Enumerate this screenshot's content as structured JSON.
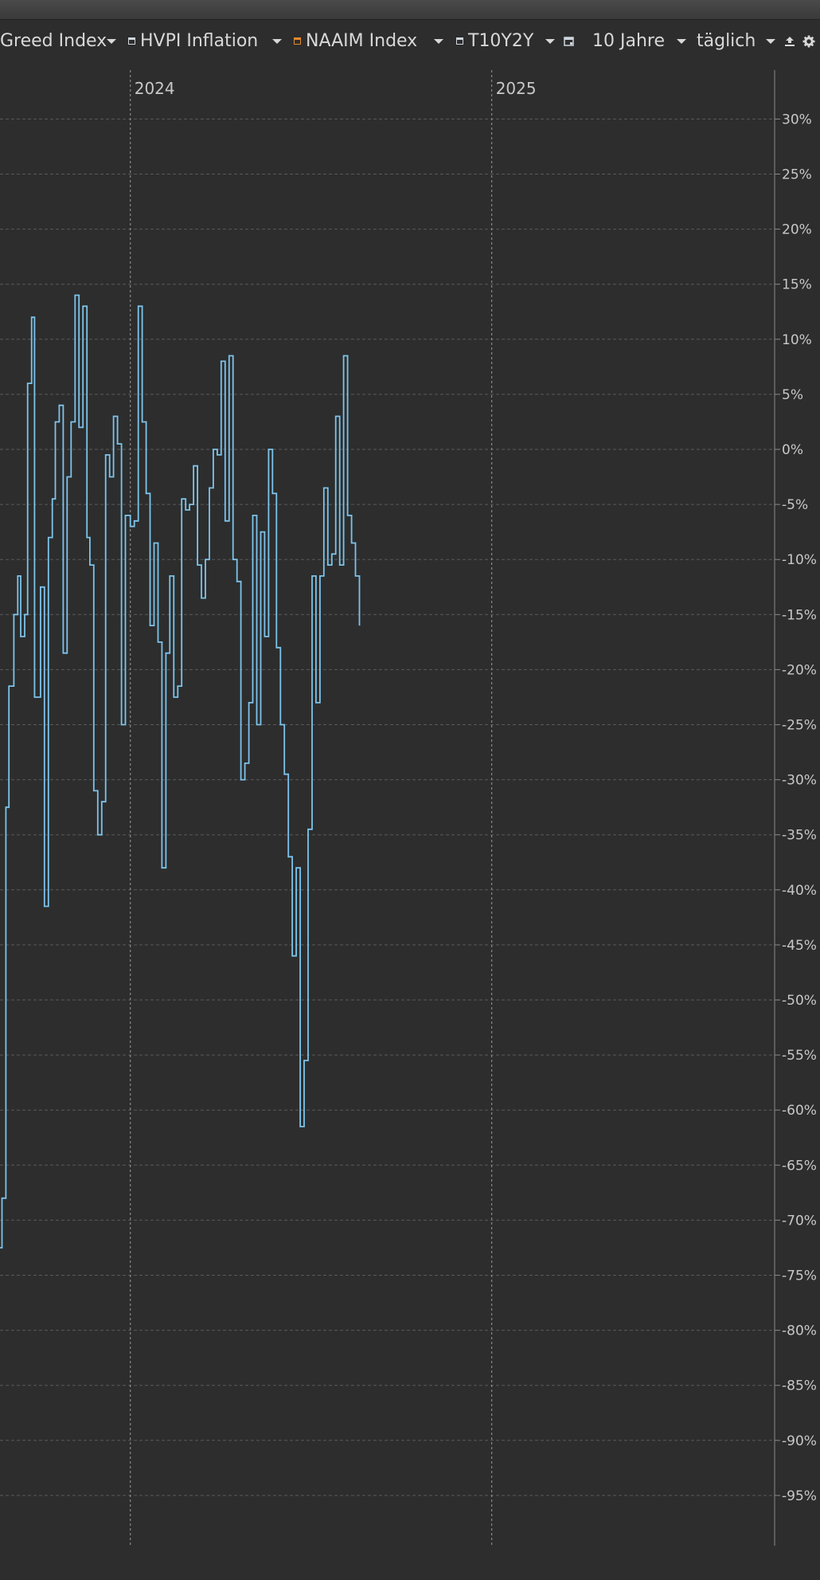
{
  "toolbar": {
    "items": [
      {
        "label": "Greed Index",
        "swatch": null
      },
      {
        "label": "HVPI Inflation",
        "swatch": "#cfd6dd"
      },
      {
        "label": "NAAIM Index",
        "swatch": "#e38a2a"
      },
      {
        "label": "T10Y2Y",
        "swatch": "#cfd6dd"
      }
    ],
    "period_label": "10 Jahre",
    "interval_label": "täglich",
    "icons": [
      "calendar-icon",
      "export-icon",
      "gear-icon"
    ]
  },
  "colors": {
    "background": "#2d2d2d",
    "line": "#7cc4ec",
    "grid": "#5a5a5a",
    "text": "#c8c8c8"
  },
  "chart_data": {
    "type": "line",
    "x_tick_labels": [
      "2024",
      "2025"
    ],
    "y_ticks": [
      "30%",
      "25%",
      "20%",
      "15%",
      "10%",
      "5%",
      "0%",
      "-5%",
      "-10%",
      "-15%",
      "-20%",
      "-25%",
      "-30%",
      "-35%",
      "-40%",
      "-45%",
      "-50%",
      "-55%",
      "-60%",
      "-65%",
      "-70%",
      "-75%",
      "-80%",
      "-85%",
      "-90%",
      "-95%"
    ],
    "ylim": [
      -100,
      33
    ],
    "x_range": [
      "2023-08-22",
      "2025-10-08"
    ],
    "grid": true,
    "line_style": "step",
    "series": [
      {
        "values": [
          [
            "2023-08-22",
            -72.5
          ],
          [
            "2023-08-24",
            -68
          ],
          [
            "2023-08-28",
            -32.5
          ],
          [
            "2023-08-31",
            -21.5
          ],
          [
            "2023-09-05",
            -15
          ],
          [
            "2023-09-09",
            -11.5
          ],
          [
            "2023-09-12",
            -17
          ],
          [
            "2023-09-16",
            -15
          ],
          [
            "2023-09-19",
            6
          ],
          [
            "2023-09-23",
            12
          ],
          [
            "2023-09-26",
            -22.5
          ],
          [
            "2023-10-02",
            -12.5
          ],
          [
            "2023-10-06",
            -41.5
          ],
          [
            "2023-10-10",
            -8
          ],
          [
            "2023-10-14",
            -4.5
          ],
          [
            "2023-10-17",
            2.5
          ],
          [
            "2023-10-21",
            4
          ],
          [
            "2023-10-25",
            -18.5
          ],
          [
            "2023-10-29",
            -2.5
          ],
          [
            "2023-11-02",
            2.5
          ],
          [
            "2023-11-06",
            14
          ],
          [
            "2023-11-10",
            2
          ],
          [
            "2023-11-14",
            13
          ],
          [
            "2023-11-18",
            -8
          ],
          [
            "2023-11-21",
            -10.5
          ],
          [
            "2023-11-25",
            -31
          ],
          [
            "2023-11-29",
            -35
          ],
          [
            "2023-12-03",
            -32
          ],
          [
            "2023-12-07",
            -0.5
          ],
          [
            "2023-12-11",
            -2.5
          ],
          [
            "2023-12-15",
            3
          ],
          [
            "2023-12-19",
            0.5
          ],
          [
            "2023-12-23",
            -25
          ],
          [
            "2023-12-27",
            -6
          ],
          [
            "2024-01-01",
            -7
          ],
          [
            "2024-01-05",
            -6.5
          ],
          [
            "2024-01-09",
            13
          ],
          [
            "2024-01-13",
            2.5
          ],
          [
            "2024-01-17",
            -4
          ],
          [
            "2024-01-21",
            -16
          ],
          [
            "2024-01-25",
            -8.5
          ],
          [
            "2024-01-29",
            -17.5
          ],
          [
            "2024-02-02",
            -38
          ],
          [
            "2024-02-06",
            -18.5
          ],
          [
            "2024-02-10",
            -11.5
          ],
          [
            "2024-02-14",
            -22.5
          ],
          [
            "2024-02-18",
            -21.5
          ],
          [
            "2024-02-22",
            -4.5
          ],
          [
            "2024-02-26",
            -5.5
          ],
          [
            "2024-03-01",
            -5
          ],
          [
            "2024-03-05",
            -1.5
          ],
          [
            "2024-03-09",
            -10.5
          ],
          [
            "2024-03-13",
            -13.5
          ],
          [
            "2024-03-17",
            -10
          ],
          [
            "2024-03-21",
            -3.5
          ],
          [
            "2024-03-25",
            0
          ],
          [
            "2024-03-29",
            -0.5
          ],
          [
            "2024-04-02",
            8
          ],
          [
            "2024-04-06",
            -6.5
          ],
          [
            "2024-04-10",
            8.5
          ],
          [
            "2024-04-14",
            -10
          ],
          [
            "2024-04-18",
            -12
          ],
          [
            "2024-04-22",
            -30
          ],
          [
            "2024-04-26",
            -28.5
          ],
          [
            "2024-04-30",
            -23
          ],
          [
            "2024-05-04",
            -6
          ],
          [
            "2024-05-08",
            -25
          ],
          [
            "2024-05-12",
            -7.5
          ],
          [
            "2024-05-16",
            -17
          ],
          [
            "2024-05-20",
            0
          ],
          [
            "2024-05-24",
            -4
          ],
          [
            "2024-05-28",
            -18
          ],
          [
            "2024-06-01",
            -25
          ],
          [
            "2024-06-05",
            -29.5
          ],
          [
            "2024-06-09",
            -37
          ],
          [
            "2024-06-13",
            -46
          ],
          [
            "2024-06-17",
            -38
          ],
          [
            "2024-06-21",
            -61.5
          ],
          [
            "2024-06-25",
            -55.5
          ],
          [
            "2024-06-29",
            -34.5
          ],
          [
            "2024-07-03",
            -11.5
          ],
          [
            "2024-07-07",
            -23
          ],
          [
            "2024-07-11",
            -11.5
          ],
          [
            "2024-07-15",
            -3.5
          ],
          [
            "2024-07-19",
            -10.5
          ],
          [
            "2024-07-23",
            -9.5
          ],
          [
            "2024-07-27",
            3
          ],
          [
            "2024-07-31",
            -10.5
          ],
          [
            "2024-08-04",
            8.5
          ],
          [
            "2024-08-08",
            -6
          ],
          [
            "2024-08-12",
            -8.5
          ],
          [
            "2024-08-16",
            -11.5
          ],
          [
            "2024-08-20",
            -16
          ]
        ]
      }
    ]
  }
}
